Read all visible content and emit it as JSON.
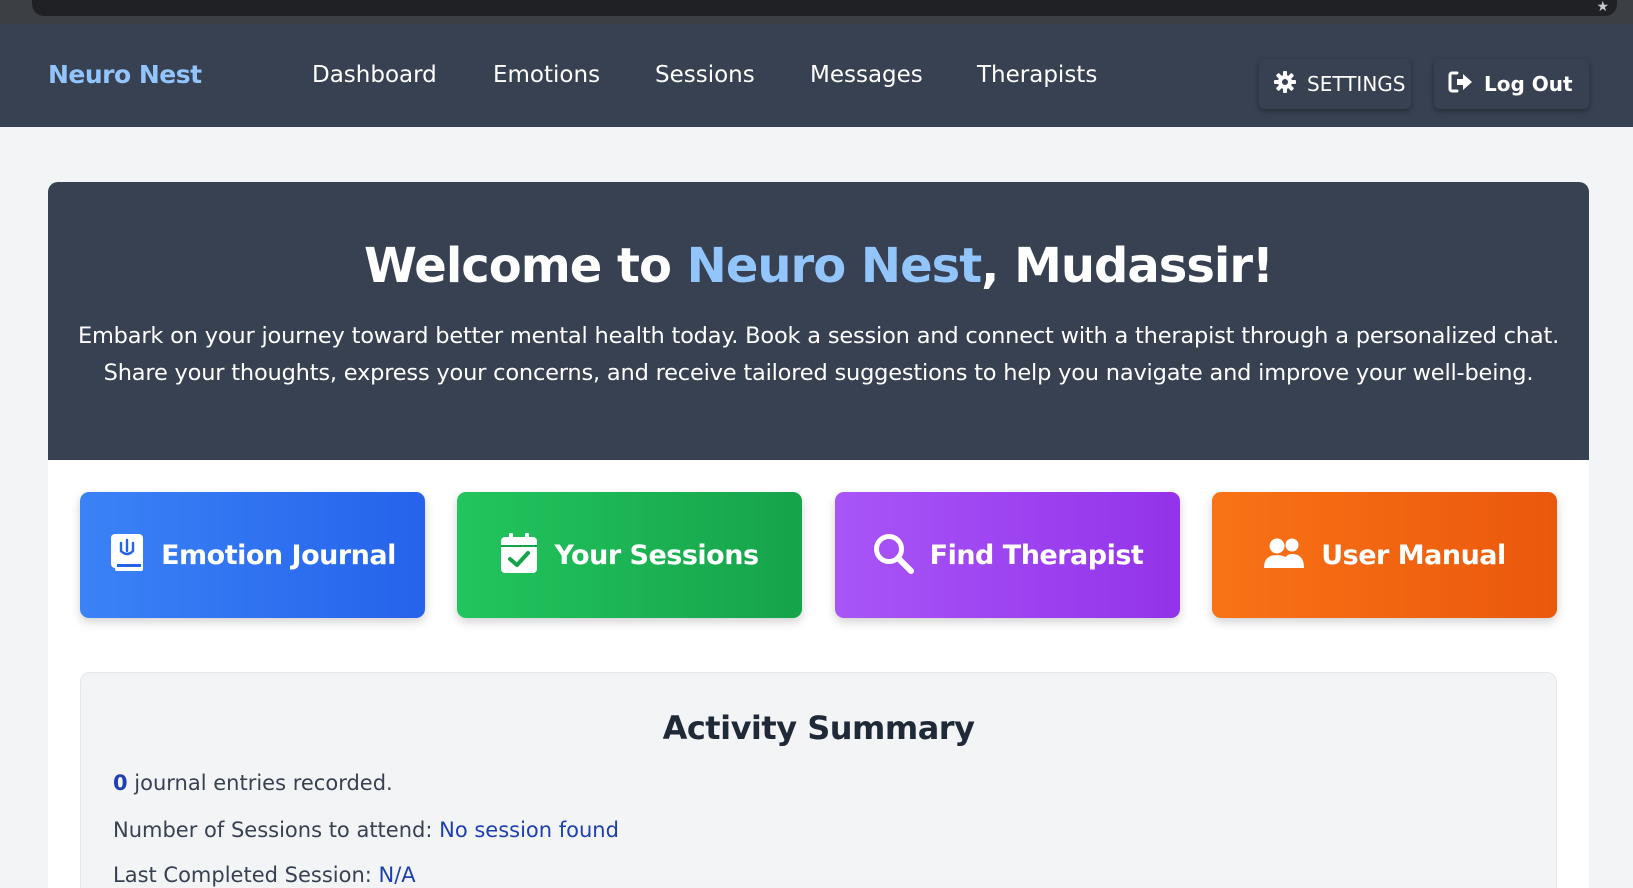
{
  "brand": {
    "name": "Neuro Nest"
  },
  "nav": {
    "links": [
      "Dashboard",
      "Emotions",
      "Sessions",
      "Messages",
      "Therapists"
    ],
    "settings_label": "SETTINGS",
    "logout_label": "Log Out"
  },
  "hero": {
    "title_prefix": "Welcome to ",
    "title_brand": "Neuro Nest",
    "title_suffix": ", Mudassir!",
    "description": "Embark on your journey toward better mental health today. Book a session and connect with a therapist through a personalized chat. Share your thoughts, express your concerns, and receive tailored suggestions to help you navigate and improve your well-being."
  },
  "actions": [
    {
      "label": "Emotion Journal",
      "icon": "journal-icon",
      "color": "#3b82f6"
    },
    {
      "label": "Your Sessions",
      "icon": "calendar-check-icon",
      "color": "#22c55e"
    },
    {
      "label": "Find Therapist",
      "icon": "search-icon",
      "color": "#a855f7"
    },
    {
      "label": "User Manual",
      "icon": "users-icon",
      "color": "#f97316"
    }
  ],
  "summary": {
    "title": "Activity Summary",
    "journal_count": "0",
    "journal_text": " journal entries recorded.",
    "sessions_label": "Number of Sessions to attend: ",
    "sessions_value": "No session found",
    "last_label": "Last Completed Session: ",
    "last_value": "N/A"
  },
  "colors": {
    "navbar": "#374151",
    "accent": "#93c5fd",
    "link": "#1e40af"
  }
}
